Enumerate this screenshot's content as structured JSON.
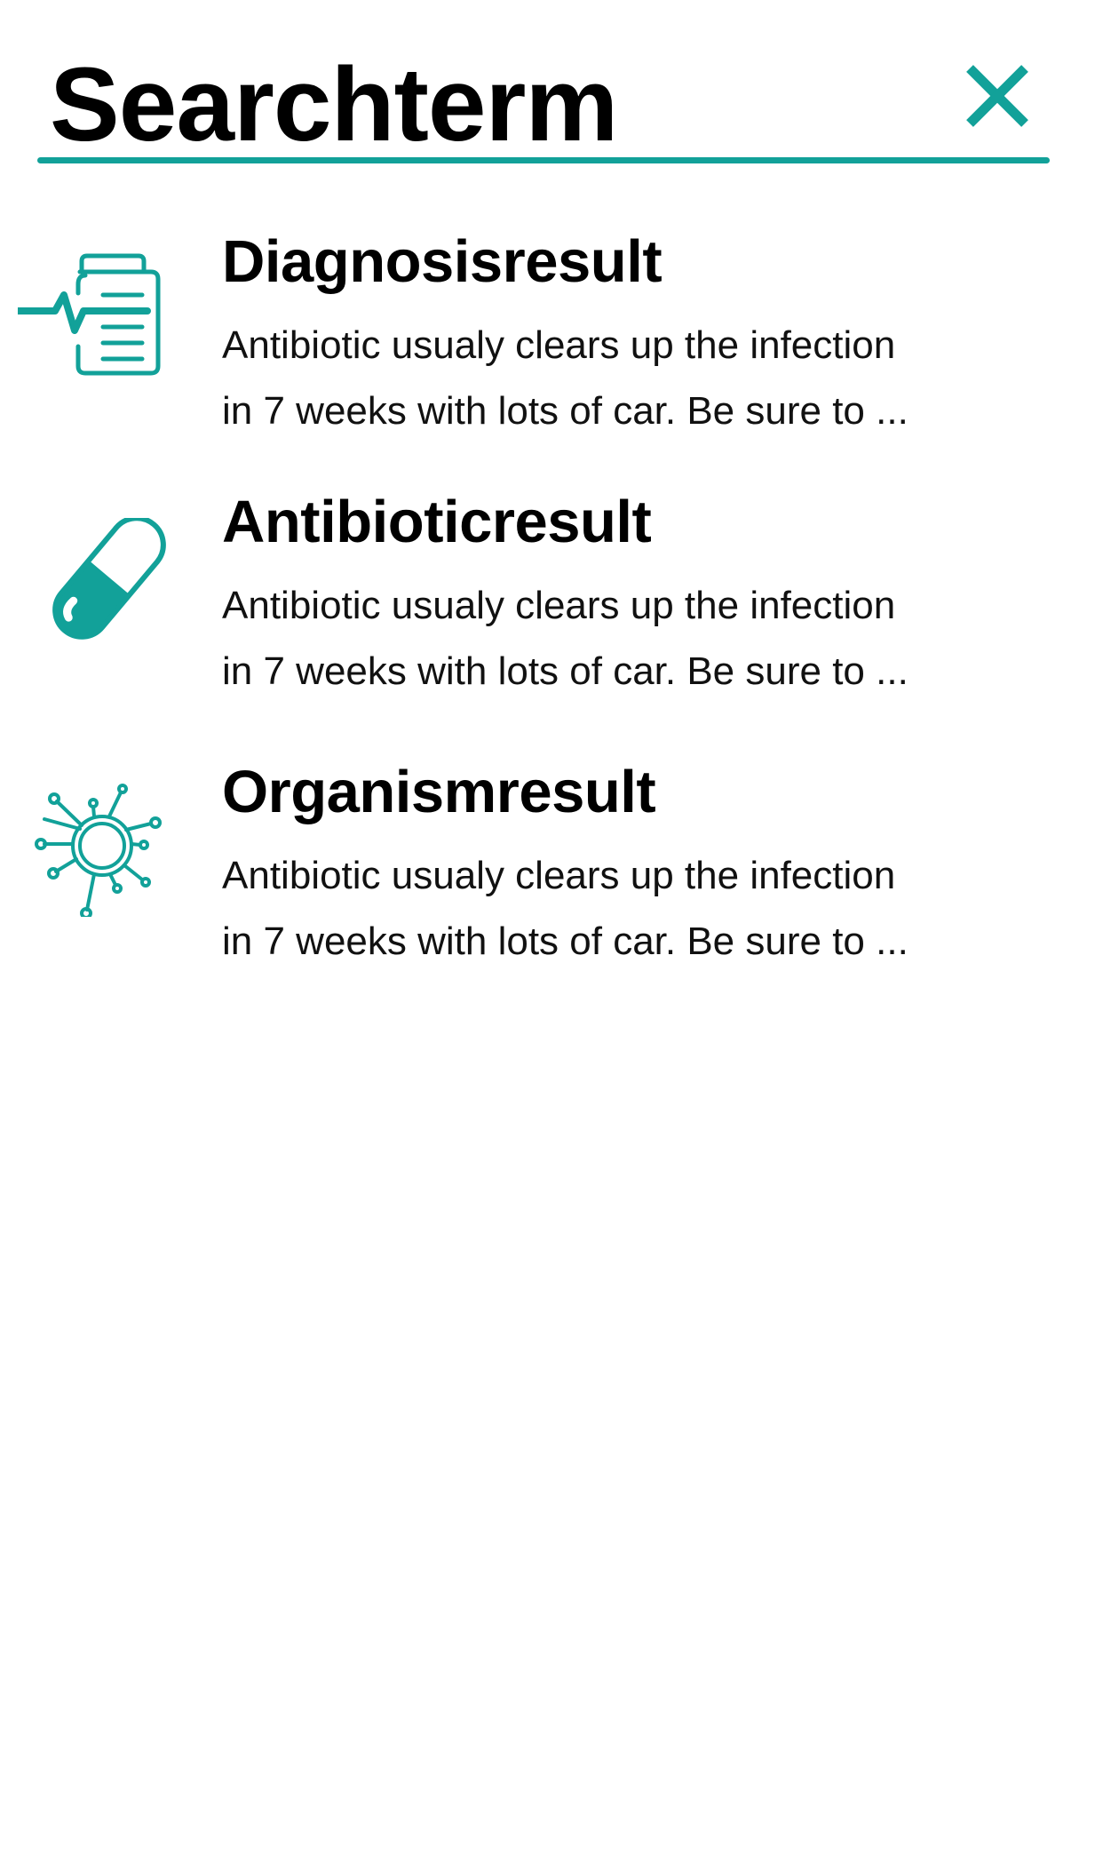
{
  "search": {
    "term": "Searchterm",
    "close_icon": "close-icon"
  },
  "colors": {
    "accent": "#12A199",
    "text": "#000000",
    "background": "#ffffff"
  },
  "results": [
    {
      "title": "Diagnosisresult",
      "icon": "clipboard-heartbeat-icon",
      "description_lines": [
        "Antibiotic usualy clears up the infection",
        "in 7 weeks with lots of car. Be sure to ..."
      ]
    },
    {
      "title": "Antibioticresult",
      "icon": "capsule-icon",
      "description_lines": [
        "Antibiotic usualy clears up the infection",
        "in 7 weeks with lots of car. Be sure to ..."
      ]
    },
    {
      "title": "Organismresult",
      "icon": "virus-icon",
      "description_lines": [
        "Antibiotic usualy clears up the infection",
        "in 7 weeks with lots of car. Be sure to ..."
      ]
    }
  ]
}
